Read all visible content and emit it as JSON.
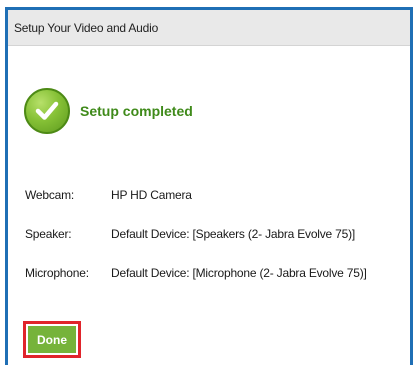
{
  "window": {
    "title": "Setup Your Video and Audio"
  },
  "status": {
    "icon": "checkmark-icon",
    "text": "Setup completed"
  },
  "devices": [
    {
      "label": "Webcam:",
      "value": "HP HD Camera"
    },
    {
      "label": "Speaker:",
      "value": "Default Device: [Speakers (2- Jabra Evolve 75)]"
    },
    {
      "label": "Microphone:",
      "value": "Default Device: [Microphone (2- Jabra Evolve 75)]"
    }
  ],
  "actions": {
    "done_label": "Done"
  },
  "colors": {
    "frame_border": "#1f6fb5",
    "accent_green": "#3f8a1a",
    "button_green": "#76b33a",
    "highlight_red": "#e0242b"
  }
}
